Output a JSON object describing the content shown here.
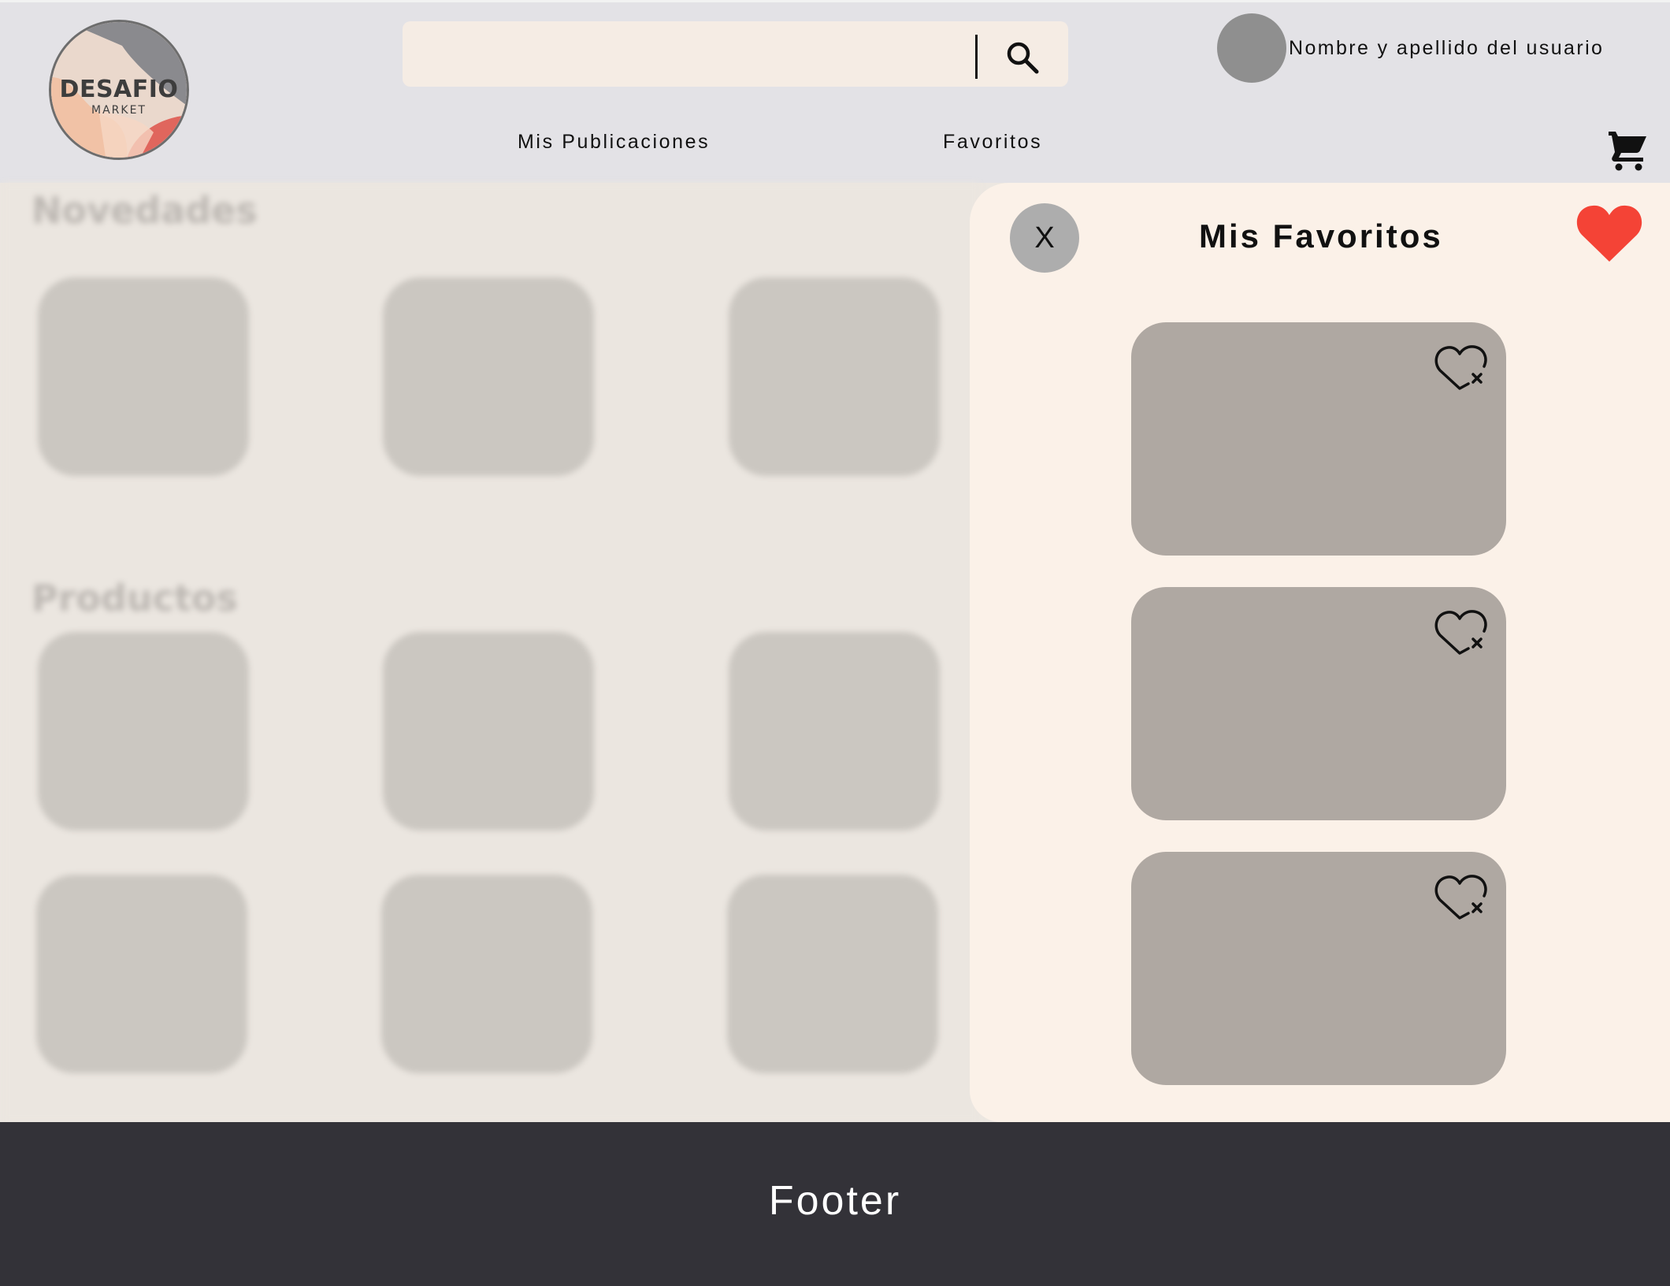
{
  "header": {
    "logo": {
      "title": "DESAFIO",
      "subtitle": "MARKET"
    },
    "search": {
      "placeholder": "",
      "value": ""
    },
    "user": {
      "name": "Nombre y apellido del usuario"
    },
    "nav": {
      "publications": "Mis Publicaciones",
      "favorites": "Favoritos"
    },
    "icons": {
      "search": "search-icon",
      "cart": "cart-icon"
    }
  },
  "main": {
    "sections": [
      {
        "title": "Novedades"
      },
      {
        "title": "Productos"
      }
    ]
  },
  "favorites_panel": {
    "title": "Mis Favoritos",
    "close_label": "X",
    "heart_color": "#f44336",
    "items_count_visible": 3
  },
  "footer": {
    "label": "Footer"
  },
  "colors": {
    "header_bg": "#e3e2e6",
    "panel_bg": "#fbf1e8",
    "card_bg": "#afa8a2",
    "footer_bg": "#333238",
    "accent_red": "#f44336"
  }
}
